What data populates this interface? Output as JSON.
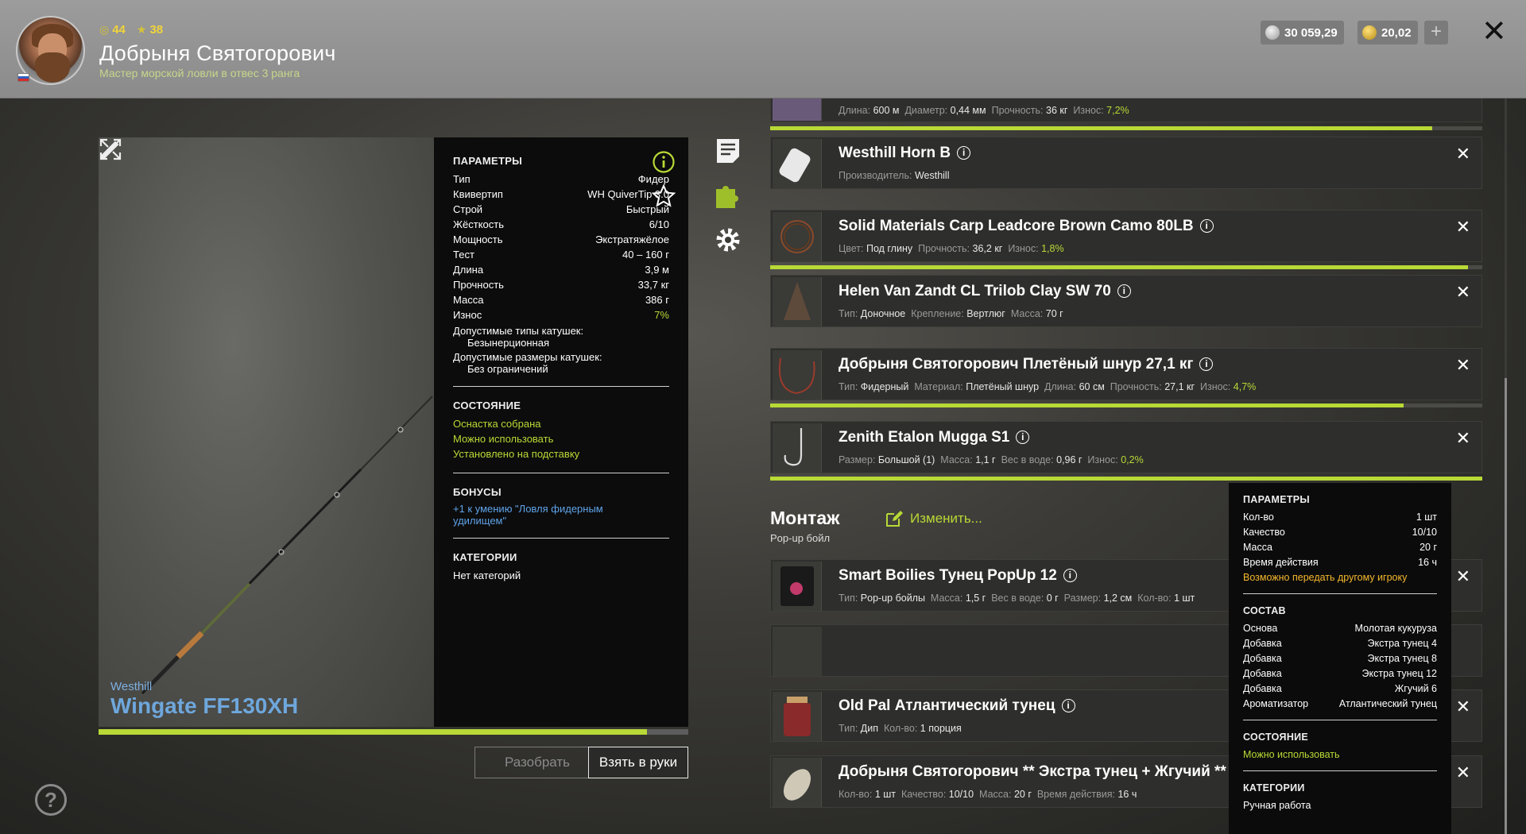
{
  "header": {
    "level": "44",
    "stars": "38",
    "player_name": "Добрыня Святогорович",
    "player_rank": "Мастер морской ловли в отвес 3 ранга",
    "silver": "30 059,29",
    "gold": "20,02",
    "plus": "+",
    "close": "✕"
  },
  "rod": {
    "brand": "Westhill",
    "name": "Wingate FF130XH",
    "wear_fraction": 0.93,
    "params_title": "ПАРАМЕТРЫ",
    "params": [
      {
        "k": "Тип",
        "v": "Фидер"
      },
      {
        "k": "Квивертип",
        "v": "WH QuiverTip 3.0"
      },
      {
        "k": "Строй",
        "v": "Быстрый"
      },
      {
        "k": "Жёсткость",
        "v": "6/10"
      },
      {
        "k": "Мощность",
        "v": "Экстратяжёлое"
      },
      {
        "k": "Тест",
        "v": "40 – 160 г"
      },
      {
        "k": "Длина",
        "v": "3,9 м"
      },
      {
        "k": "Прочность",
        "v": "33,7 кг"
      },
      {
        "k": "Масса",
        "v": "386 г"
      },
      {
        "k": "Износ",
        "v": "7%"
      }
    ],
    "reel_types_label": "Допустимые типы катушек:",
    "reel_types_value": "Безынерционная",
    "reel_sizes_label": "Допустимые размеры катушек:",
    "reel_sizes_value": "Без ограничений",
    "state_title": "СОСТОЯНИЕ",
    "state": [
      "Оснастка собрана",
      "Можно использовать",
      "Установлено на подставку"
    ],
    "bonus_title": "БОНУСЫ",
    "bonus": "+1 к умению \"Ловля фидерным удилищем\"",
    "cat_title": "КАТЕГОРИИ",
    "cat": "Нет категорий",
    "btn_disassemble": "Разобрать",
    "btn_take": "Взять в руки",
    "help": "?"
  },
  "tackle": {
    "line_meta": {
      "l1": "Длина:",
      "v1": "600 м",
      "l2": "Диаметр:",
      "v2": "0,44 мм",
      "l3": "Прочность:",
      "v3": "36 кг",
      "l4": "Износ:",
      "v4": "7,2%"
    },
    "items": [
      {
        "title": "Westhill Horn B",
        "l1": "Производитель:",
        "v1": "Westhill"
      },
      {
        "title": "Solid Materials Carp Leadcore Brown Camo 80LB",
        "l1": "Цвет:",
        "v1": "Под глину",
        "l2": "Прочность:",
        "v2": "36,2 кг",
        "l3": "Износ:",
        "v3": "1,8%"
      },
      {
        "title": "Helen Van Zandt CL Trilob Clay SW 70",
        "l1": "Тип:",
        "v1": "Доночное",
        "l2": "Крепление:",
        "v2": "Вертлюг",
        "l3": "Масса:",
        "v3": "70 г"
      },
      {
        "title": "Добрыня Святогорович Плетёный шнур 27,1 кг",
        "l1": "Тип:",
        "v1": "Фидерный",
        "l2": "Материал:",
        "v2": "Плетёный шнур",
        "l3": "Длина:",
        "v3": "60 см",
        "l4": "Прочность:",
        "v4": "27,1 кг",
        "l5": "Износ:",
        "v5": "4,7%"
      },
      {
        "title": "Zenith Etalon Mugga S1",
        "l1": "Размер:",
        "v1": "Большой (1)",
        "l2": "Масса:",
        "v2": "1,1 г",
        "l3": "Вес в воде:",
        "v3": "0,96 г",
        "l4": "Износ:",
        "v4": "0,2%"
      }
    ],
    "wear": [
      0.93,
      0.98,
      0.89,
      1.0
    ]
  },
  "montazh": {
    "title": "Монтаж",
    "subtitle": "Pop-up бойл",
    "change": "Изменить...",
    "items": [
      {
        "title": "Smart Boilies Тунец PopUp 12",
        "l1": "Тип:",
        "v1": "Pop-up бойлы",
        "l2": "Масса:",
        "v2": "1,5 г",
        "l3": "Вес в воде:",
        "v3": "0 г",
        "l4": "Размер:",
        "v4": "1,2 см",
        "l5": "Кол-во:",
        "v5": "1 шт"
      },
      {
        "title": "Old Pal Атлантический тунец",
        "l1": "Тип:",
        "v1": "Дип",
        "l2": "Кол-во:",
        "v2": "1 порция"
      },
      {
        "title": "Добрыня Святогорович ** Экстра тунец + Жгучий **",
        "l1": "Кол-во:",
        "v1": "1 шт",
        "l2": "Качество:",
        "v2": "10/10",
        "l3": "Масса:",
        "v3": "20 г",
        "l4": "Время действия:",
        "v4": "16 ч"
      }
    ]
  },
  "tooltip": {
    "params_title": "ПАРАМЕТРЫ",
    "params": [
      {
        "k": "Кол-во",
        "v": "1 шт"
      },
      {
        "k": "Качество",
        "v": "10/10"
      },
      {
        "k": "Масса",
        "v": "20 г"
      },
      {
        "k": "Время действия",
        "v": "16 ч"
      }
    ],
    "transfer": "Возможно передать другому игроку",
    "comp_title": "СОСТАВ",
    "composition": [
      {
        "k": "Основа",
        "v": "Молотая кукуруза"
      },
      {
        "k": "Добавка",
        "v": "Экстра тунец 4"
      },
      {
        "k": "Добавка",
        "v": "Экстра тунец 8"
      },
      {
        "k": "Добавка",
        "v": "Экстра тунец 12"
      },
      {
        "k": "Добавка",
        "v": "Жгучий 6"
      },
      {
        "k": "Ароматизатор",
        "v": "Атлантический тунец"
      }
    ],
    "state_title": "СОСТОЯНИЕ",
    "state": "Можно использовать",
    "cat_title": "КАТЕГОРИИ",
    "cat": "Ручная работа"
  },
  "colors": {
    "accent": "#b8d936",
    "link": "#5fa3e8",
    "warning": "#f5b82e"
  }
}
